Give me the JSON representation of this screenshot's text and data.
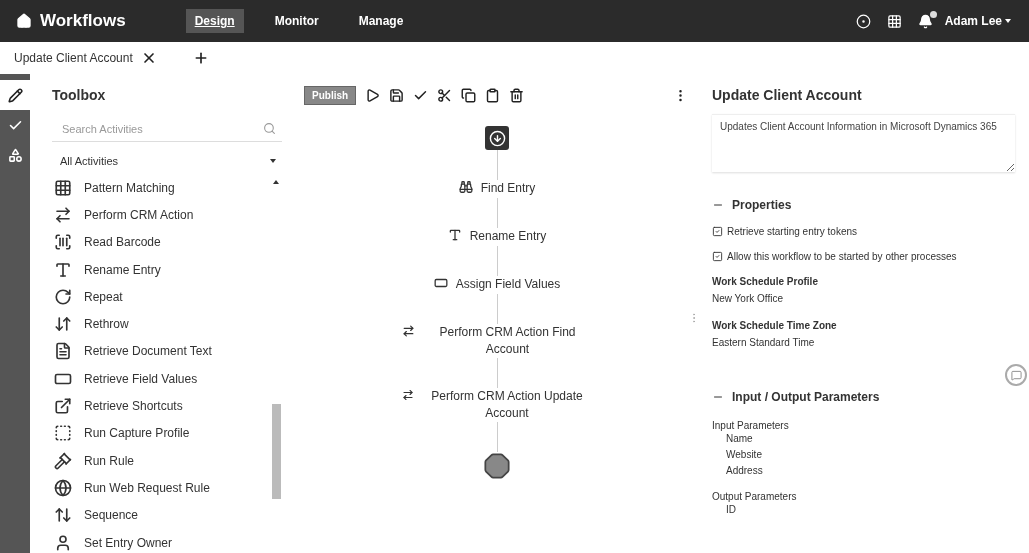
{
  "topbar": {
    "title": "Workflows",
    "nav": [
      {
        "label": "Design",
        "selected": true
      },
      {
        "label": "Monitor",
        "selected": false
      },
      {
        "label": "Manage",
        "selected": false
      }
    ],
    "user": "Adam Lee"
  },
  "doc_tabs": [
    {
      "label": "Update Client Account",
      "selected": true
    }
  ],
  "rail": [
    {
      "kind": "pencil",
      "selected": true
    },
    {
      "kind": "check",
      "selected": false
    },
    {
      "kind": "shapes",
      "selected": false
    }
  ],
  "toolbox": {
    "title": "Toolbox",
    "search": {
      "placeholder": "Search Activities"
    },
    "filter": "All Activities",
    "activities": [
      {
        "label": "Pattern Matching",
        "kind": "grid"
      },
      {
        "label": "Perform CRM Action",
        "kind": "arrows"
      },
      {
        "label": "Read Barcode",
        "kind": "barcode"
      },
      {
        "label": "Rename Entry",
        "kind": "rename"
      },
      {
        "label": "Repeat",
        "kind": "repeat"
      },
      {
        "label": "Rethrow",
        "kind": "rethrow"
      },
      {
        "label": "Retrieve Document Text",
        "kind": "doctext"
      },
      {
        "label": "Retrieve Field Values",
        "kind": "fields"
      },
      {
        "label": "Retrieve Shortcuts",
        "kind": "shortcut"
      },
      {
        "label": "Run Capture Profile",
        "kind": "capture"
      },
      {
        "label": "Run Rule",
        "kind": "rule"
      },
      {
        "label": "Run Web Request Rule",
        "kind": "globe"
      },
      {
        "label": "Sequence",
        "kind": "sequence"
      },
      {
        "label": "Set Entry Owner",
        "kind": "owner"
      }
    ]
  },
  "toolbar": {
    "publish": "Publish"
  },
  "canvas": {
    "nodes": [
      {
        "kind": "start"
      },
      {
        "kind": "activity",
        "label": "Find Entry"
      },
      {
        "kind": "activity",
        "label": "Rename Entry"
      },
      {
        "kind": "activity",
        "label": "Assign Field Values"
      },
      {
        "kind": "activity",
        "label": "Perform CRM Action Find Account"
      },
      {
        "kind": "activity",
        "label": "Perform CRM Action Update Account"
      },
      {
        "kind": "end"
      }
    ]
  },
  "properties": {
    "title": "Update Client Account",
    "description": "Updates Client Account Information in Microsoft Dynamics 365",
    "sections": [
      {
        "title": "Properties",
        "expanded": true,
        "checkboxes": [
          {
            "label": "Retrieve starting entry tokens",
            "checked": true
          },
          {
            "label": "Allow this workflow to be started by other processes",
            "checked": true
          }
        ],
        "fields": [
          {
            "label": "Work Schedule Profile",
            "value": "New York Office"
          },
          {
            "label": "Work Schedule Time Zone",
            "value": "Eastern Standard Time"
          }
        ]
      },
      {
        "title": "Input / Output Parameters",
        "expanded": true,
        "groups": [
          {
            "label": "Input Parameters",
            "items": [
              "Name",
              "Website",
              "Address"
            ]
          },
          {
            "label": "Output Parameters",
            "items": [
              "ID"
            ]
          }
        ]
      }
    ]
  }
}
